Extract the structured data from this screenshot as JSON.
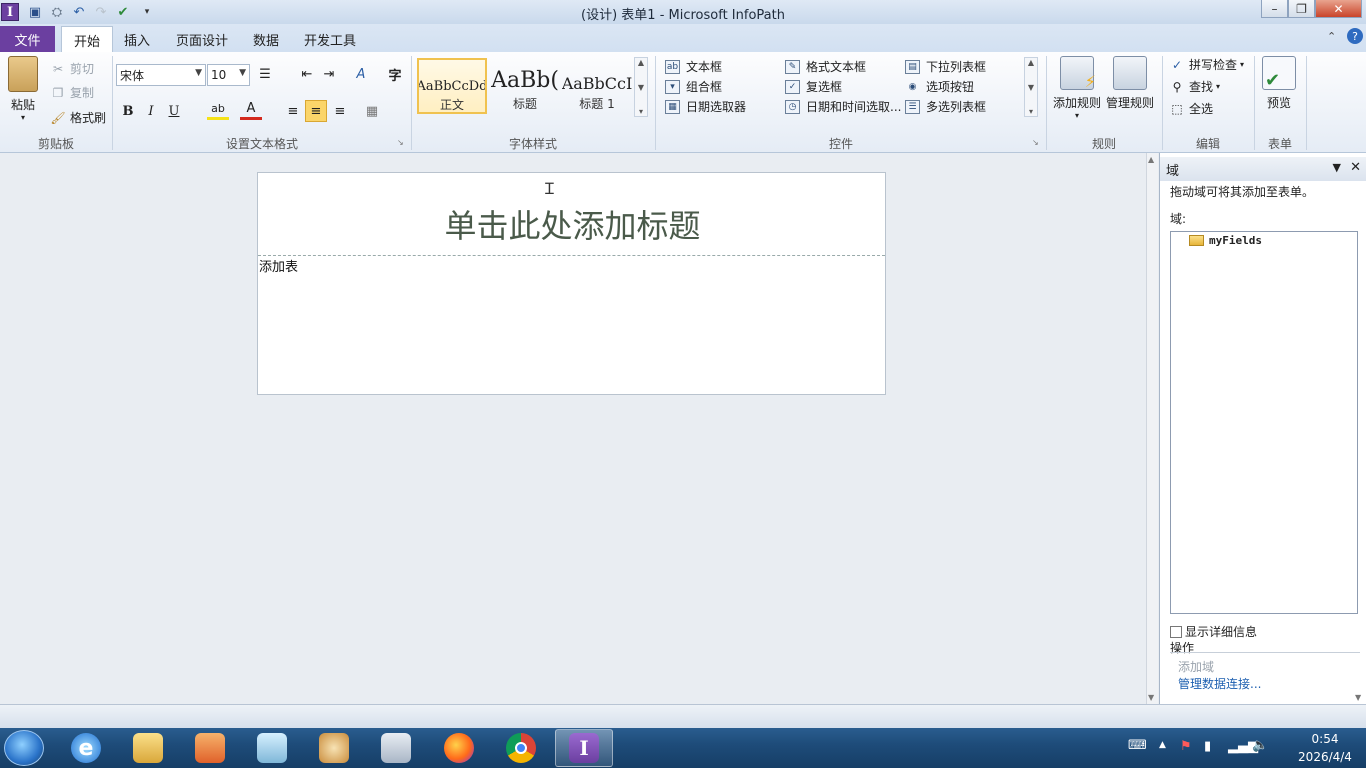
{
  "window": {
    "title": "(设计) 表单1  -  Microsoft InfoPath",
    "qat_icons": [
      "infopath-logo-icon",
      "save-icon",
      "publish-icon",
      "undo-icon",
      "redo-icon",
      "check-icon",
      "customize-icon"
    ]
  },
  "tabs": [
    "文件",
    "开始",
    "插入",
    "页面设计",
    "数据",
    "开发工具"
  ],
  "ribbon": {
    "clipboard": {
      "paste": "粘贴",
      "cut": "剪切",
      "copy": "复制",
      "format_painter": "格式刷",
      "label": "剪贴板"
    },
    "font": {
      "family": "宋体",
      "size": "10",
      "label": "设置文本格式",
      "bold": "B",
      "italic": "I",
      "underline": "U",
      "char_glyph": "字",
      "highlight": "ab",
      "font_color": "A"
    },
    "styles": {
      "label": "字体样式",
      "items": [
        {
          "sample": "AaBbCcDd",
          "name": "正文"
        },
        {
          "sample": "AaBb(",
          "name": "标题"
        },
        {
          "sample": "AaBbCcI",
          "name": "标题 1"
        }
      ]
    },
    "controls": {
      "label": "控件",
      "items": [
        "文本框",
        "格式文本框",
        "下拉列表框",
        "组合框",
        "复选框",
        "选项按钮",
        "日期选取器",
        "日期和时间选取...",
        "多选列表框"
      ]
    },
    "rules": {
      "label": "规则",
      "add": "添加规则",
      "manage": "管理规则"
    },
    "editing": {
      "label": "编辑",
      "spell": "拼写检查",
      "find": "查找",
      "select_all": "全选"
    },
    "form": {
      "label": "表单",
      "preview": "预览"
    }
  },
  "form": {
    "title_placeholder": "单击此处添加标题",
    "body_text": "添加表"
  },
  "fields_pane": {
    "title": "域",
    "hint": "拖动域可将其添加至表单。",
    "fields_label": "域:",
    "root_field": "myFields",
    "show_details": "显示详细信息",
    "actions_label": "操作",
    "add_field": "添加域",
    "manage_connections": "管理数据连接..."
  },
  "taskbar": {
    "time": "0:54",
    "date": "2026/4/4"
  }
}
